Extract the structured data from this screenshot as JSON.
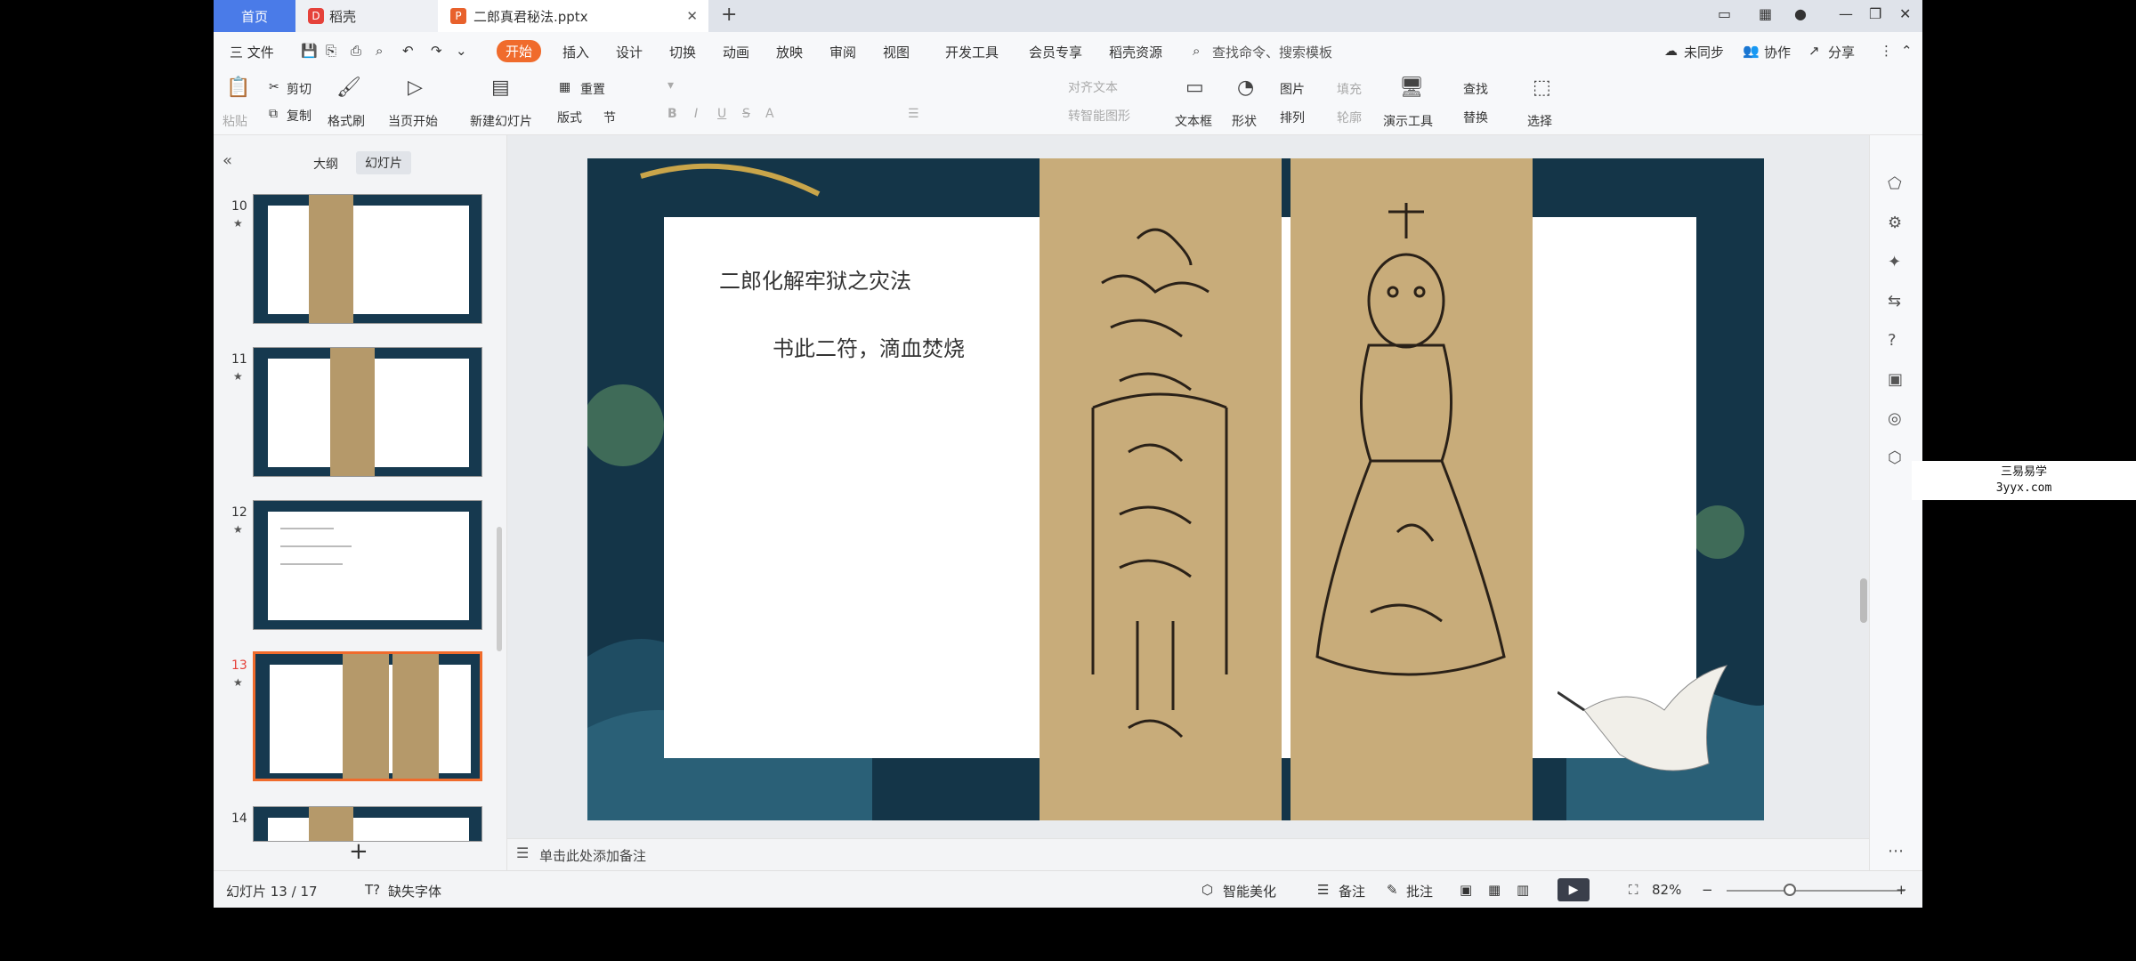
{
  "tabs": {
    "home": "首页",
    "daoke": "稻壳",
    "doc": "二郎真君秘法.pptx"
  },
  "menu": {
    "file": "三 文件",
    "start": "开始",
    "insert": "插入",
    "design": "设计",
    "transition": "切换",
    "animation": "动画",
    "slideshow": "放映",
    "review": "审阅",
    "view": "视图",
    "devtools": "开发工具",
    "member": "会员专享",
    "resources": "稻壳资源",
    "search": "查找命令、搜索模板",
    "sync": "未同步",
    "collab": "协作",
    "share": "分享"
  },
  "ribbon": {
    "paste": "粘贴",
    "cut": "剪切",
    "copy": "复制",
    "format_painter": "格式刷",
    "from_current": "当页开始",
    "new_slide": "新建幻灯片",
    "layout": "版式",
    "section": "节",
    "reset": "重置",
    "text_box": "文本框",
    "shapes": "形状",
    "picture": "图片",
    "fill": "填充",
    "arrange": "排列",
    "outline": "轮廓",
    "presenter_tools": "演示工具",
    "find": "查找",
    "replace": "替换",
    "select": "选择",
    "align_text": "对齐文本",
    "convert_smartart": "转智能图形"
  },
  "left_panel": {
    "outline_tab": "大纲",
    "slides_tab": "幻灯片",
    "thumbs": [
      "10",
      "11",
      "12",
      "13",
      "14"
    ]
  },
  "slide": {
    "title": "二郎化解牢狱之灾法",
    "body": "书此二符，滴血焚烧"
  },
  "notes_placeholder": "单击此处添加备注",
  "status": {
    "slide_counter": "幻灯片 13 / 17",
    "missing_font": "缺失字体",
    "beautify": "智能美化",
    "notes": "备注",
    "comments": "批注",
    "zoom": "82%"
  },
  "watermark": {
    "line1": "三易易学",
    "line2": "3yyx.com"
  }
}
